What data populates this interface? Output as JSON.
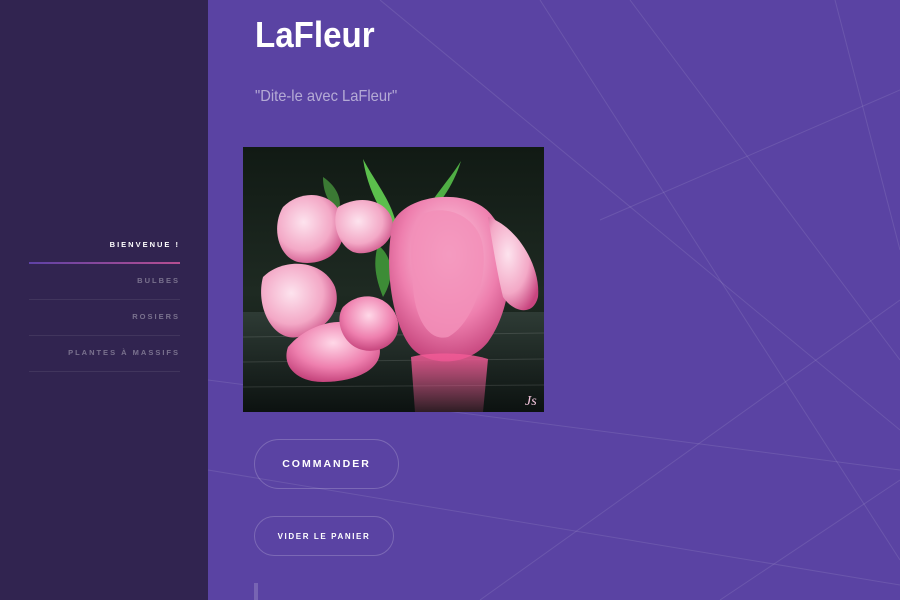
{
  "header": {
    "title": "LaFleur",
    "tagline": "\"Dite-le avec LaFleur\""
  },
  "sidebar": {
    "items": [
      {
        "label": "Bienvenue !",
        "active": true
      },
      {
        "label": "Bulbes",
        "active": false
      },
      {
        "label": "Rosiers",
        "active": false
      },
      {
        "label": "Plantes à massifs",
        "active": false
      }
    ]
  },
  "main": {
    "image": {
      "icon": "rose-image"
    },
    "order_button": "Commander",
    "clear_cart_button": "Vider le panier"
  },
  "colors": {
    "sidebar_bg": "#312450",
    "main_bg": "#5a43a3",
    "accent_gradient_start": "#5e42a6",
    "accent_gradient_end": "#b74e91"
  }
}
